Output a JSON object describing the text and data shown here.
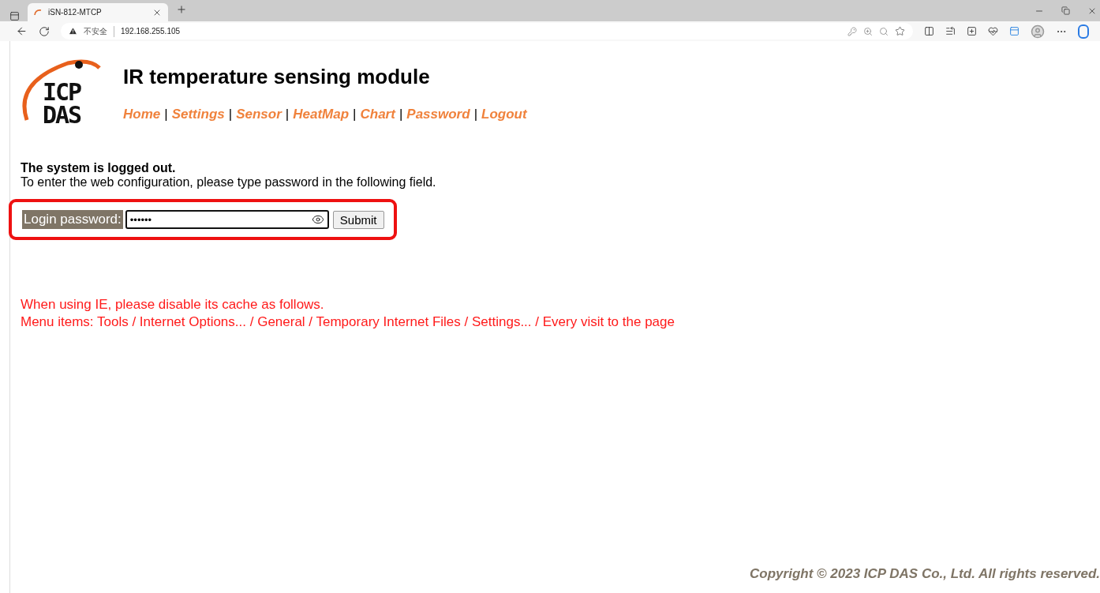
{
  "browser": {
    "tab_title": "iSN-812-MTCP",
    "security_label": "不安全",
    "address": "192.168.255.105"
  },
  "logo": {
    "line_1": "ICP",
    "line_2": "DAS"
  },
  "title": "IR temperature sensing module",
  "nav": [
    {
      "label": "Home"
    },
    {
      "label": "Settings"
    },
    {
      "label": "Sensor"
    },
    {
      "label": "HeatMap"
    },
    {
      "label": "Chart"
    },
    {
      "label": "Password"
    },
    {
      "label": "Logout"
    }
  ],
  "nav_separator": "|",
  "status": {
    "heading": "The system is logged out.",
    "message": "To enter the web configuration, please type password in the following field."
  },
  "login": {
    "label": "Login password:",
    "value": "••••••",
    "button": "Submit",
    "highlighted": true
  },
  "notes": [
    "When using IE, please disable its cache as follows.",
    "Menu items: Tools / Internet Options... / General / Temporary Internet Files / Settings... / Every visit to the page"
  ],
  "footer": "Copyright © 2023 ICP DAS Co., Ltd. All rights reserved."
}
